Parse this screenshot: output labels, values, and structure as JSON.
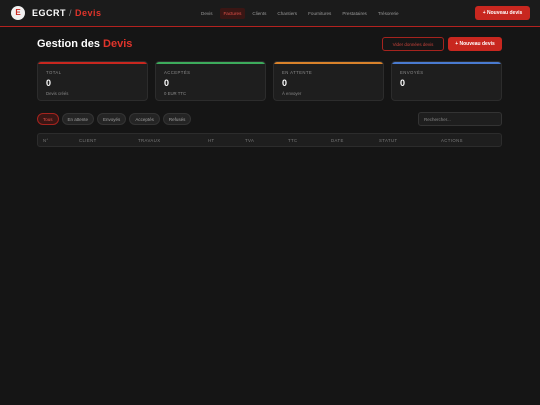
{
  "brand": {
    "logo_letter": "E",
    "name_part1": "EGCRT",
    "separator": "/",
    "name_part2": "Devis"
  },
  "nav": {
    "items": [
      {
        "label": "Devis",
        "active": false
      },
      {
        "label": "Factures",
        "active": true
      },
      {
        "label": "Clients",
        "active": false
      },
      {
        "label": "Chantiers",
        "active": false
      },
      {
        "label": "Fournitures",
        "active": false
      },
      {
        "label": "Prestataires",
        "active": false
      },
      {
        "label": "Trésorerie",
        "active": false
      }
    ],
    "new_button": "+ Nouveau devis"
  },
  "header": {
    "title_part1": "Gestion des",
    "title_part2": "Devis",
    "outline_button": "Vider données devis",
    "new_button": "+ Nouveau devis"
  },
  "stats": [
    {
      "label": "TOTAL",
      "value": "0",
      "sub": "Devis créés",
      "color": "#c8271f"
    },
    {
      "label": "ACCEPTÉS",
      "value": "0",
      "sub": "0 EUR TTC",
      "color": "#3dab5c"
    },
    {
      "label": "EN ATTENTE",
      "value": "0",
      "sub": "À envoyer",
      "color": "#d9822b"
    },
    {
      "label": "ENVOYÉS",
      "value": "0",
      "sub": "",
      "color": "#4a7bd0"
    }
  ],
  "filters": [
    {
      "label": "Tous",
      "active": true
    },
    {
      "label": "En attente",
      "active": false
    },
    {
      "label": "Envoyés",
      "active": false
    },
    {
      "label": "Acceptés",
      "active": false
    },
    {
      "label": "Refusés",
      "active": false
    }
  ],
  "search": {
    "placeholder": "Rechercher..."
  },
  "table": {
    "columns": [
      "N°",
      "CLIENT",
      "TRAVAUX",
      "HT",
      "TVA",
      "TTC",
      "DATE",
      "STATUT",
      "ACTIONS"
    ]
  }
}
